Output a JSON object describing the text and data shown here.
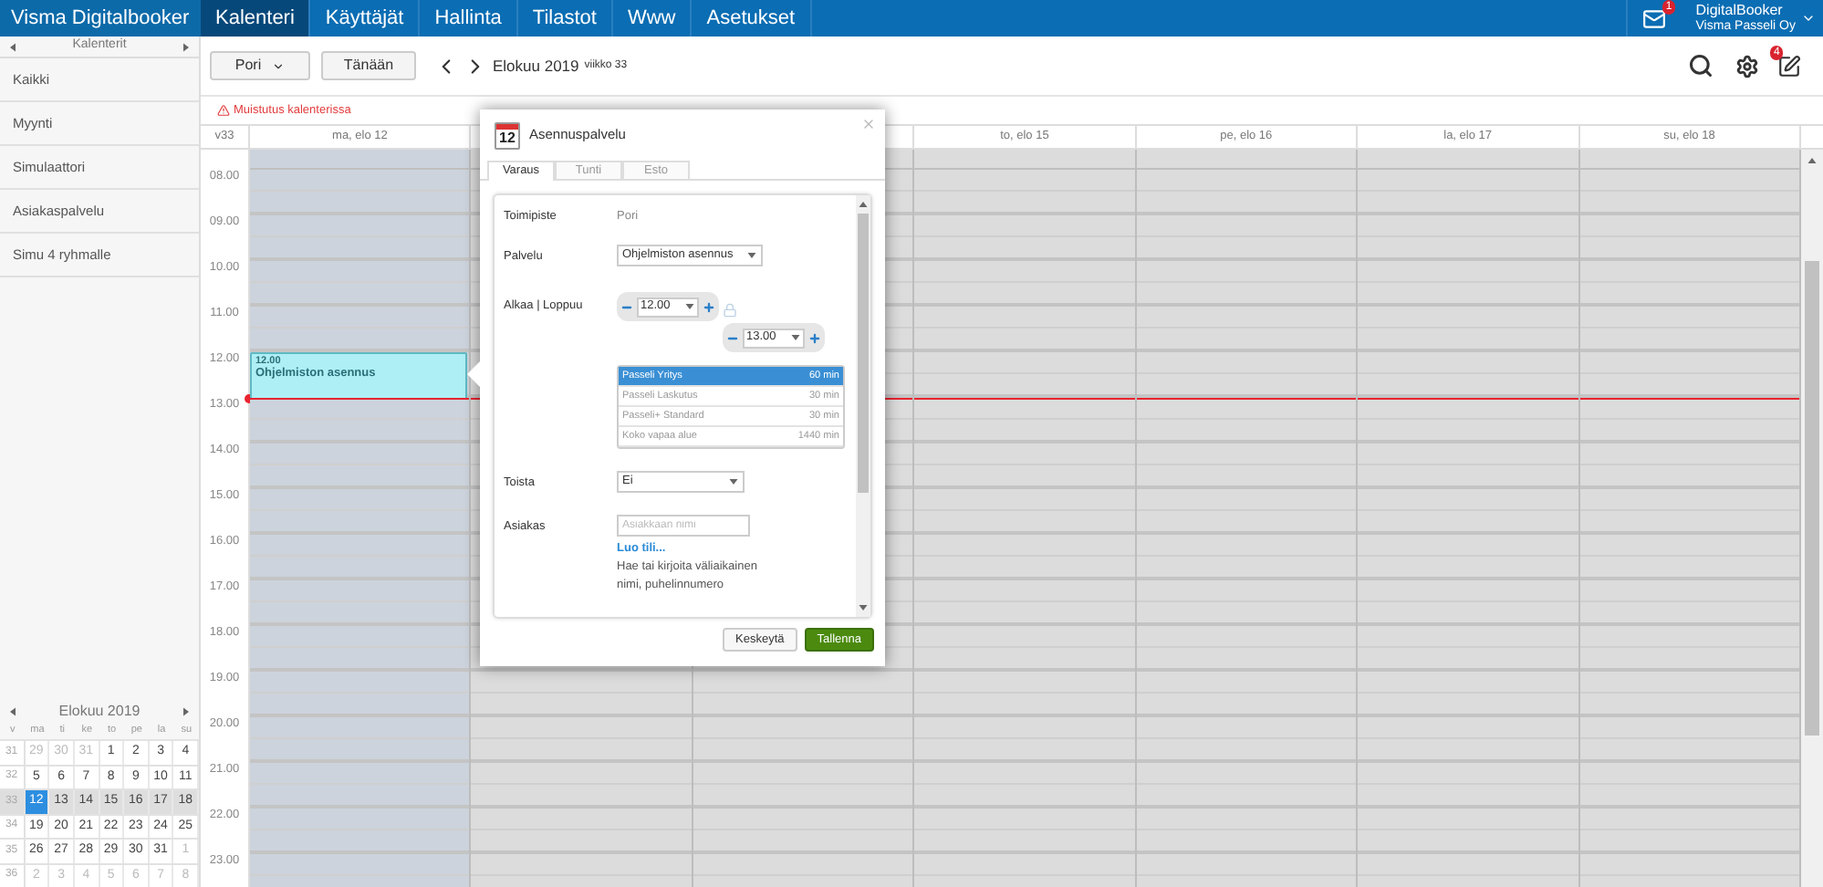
{
  "brand": "Visma Digitalbooker",
  "nav": [
    {
      "label": "Kalenteri",
      "selected": true
    },
    {
      "label": "Käyttäjät",
      "selected": false
    },
    {
      "label": "Hallinta",
      "selected": false
    },
    {
      "label": "Tilastot",
      "selected": false
    },
    {
      "label": "Www",
      "selected": false
    },
    {
      "label": "Asetukset",
      "selected": false
    }
  ],
  "mail_badge": "1",
  "user": {
    "name": "DigitalBooker",
    "company": "Visma Passeli Oy"
  },
  "sidebar": {
    "title": "Kalenterit",
    "items": [
      {
        "label": "Kaikki"
      },
      {
        "label": "Myynti"
      },
      {
        "label": "Simulaattori"
      },
      {
        "label": "Asiakaspalvelu"
      },
      {
        "label": "Simu 4 ryhmalle"
      }
    ]
  },
  "mini_calendar": {
    "title": "Elokuu 2019",
    "weekdays": [
      "v",
      "ma",
      "ti",
      "ke",
      "to",
      "pe",
      "la",
      "su"
    ],
    "weeks": [
      {
        "number": "31",
        "selected": false,
        "days": [
          {
            "label": "29",
            "muted": true,
            "selected": false
          },
          {
            "label": "30",
            "muted": true,
            "selected": false
          },
          {
            "label": "31",
            "muted": true,
            "selected": false
          },
          {
            "label": "1",
            "muted": false,
            "selected": false
          },
          {
            "label": "2",
            "muted": false,
            "selected": false
          },
          {
            "label": "3",
            "muted": false,
            "selected": false
          },
          {
            "label": "4",
            "muted": false,
            "selected": false
          }
        ]
      },
      {
        "number": "32",
        "selected": false,
        "days": [
          {
            "label": "5",
            "muted": false,
            "selected": false
          },
          {
            "label": "6",
            "muted": false,
            "selected": false
          },
          {
            "label": "7",
            "muted": false,
            "selected": false
          },
          {
            "label": "8",
            "muted": false,
            "selected": false
          },
          {
            "label": "9",
            "muted": false,
            "selected": false
          },
          {
            "label": "10",
            "muted": false,
            "selected": false
          },
          {
            "label": "11",
            "muted": false,
            "selected": false
          }
        ]
      },
      {
        "number": "33",
        "selected": true,
        "days": [
          {
            "label": "12",
            "muted": false,
            "selected": true
          },
          {
            "label": "13",
            "muted": false,
            "selected": false
          },
          {
            "label": "14",
            "muted": false,
            "selected": false
          },
          {
            "label": "15",
            "muted": false,
            "selected": false
          },
          {
            "label": "16",
            "muted": false,
            "selected": false
          },
          {
            "label": "17",
            "muted": false,
            "selected": false
          },
          {
            "label": "18",
            "muted": false,
            "selected": false
          }
        ]
      },
      {
        "number": "34",
        "selected": false,
        "days": [
          {
            "label": "19",
            "muted": false,
            "selected": false
          },
          {
            "label": "20",
            "muted": false,
            "selected": false
          },
          {
            "label": "21",
            "muted": false,
            "selected": false
          },
          {
            "label": "22",
            "muted": false,
            "selected": false
          },
          {
            "label": "23",
            "muted": false,
            "selected": false
          },
          {
            "label": "24",
            "muted": false,
            "selected": false
          },
          {
            "label": "25",
            "muted": false,
            "selected": false
          }
        ]
      },
      {
        "number": "35",
        "selected": false,
        "days": [
          {
            "label": "26",
            "muted": false,
            "selected": false
          },
          {
            "label": "27",
            "muted": false,
            "selected": false
          },
          {
            "label": "28",
            "muted": false,
            "selected": false
          },
          {
            "label": "29",
            "muted": false,
            "selected": false
          },
          {
            "label": "30",
            "muted": false,
            "selected": false
          },
          {
            "label": "31",
            "muted": false,
            "selected": false
          },
          {
            "label": "1",
            "muted": true,
            "selected": false
          }
        ]
      },
      {
        "number": "36",
        "selected": false,
        "days": [
          {
            "label": "2",
            "muted": true,
            "selected": false
          },
          {
            "label": "3",
            "muted": true,
            "selected": false
          },
          {
            "label": "4",
            "muted": true,
            "selected": false
          },
          {
            "label": "5",
            "muted": true,
            "selected": false
          },
          {
            "label": "6",
            "muted": true,
            "selected": false
          },
          {
            "label": "7",
            "muted": true,
            "selected": false
          },
          {
            "label": "8",
            "muted": true,
            "selected": false
          }
        ]
      }
    ]
  },
  "toolbar": {
    "location": "Pori",
    "today": "Tänään",
    "month": "Elokuu 2019",
    "week": "viikko 33",
    "edit_badge": "4"
  },
  "alert": "Muistutus kalenterissa",
  "calendar": {
    "week_label": "v33",
    "days": [
      {
        "label": "ma, elo 12",
        "selected": true,
        "events": [
          {
            "time": "12.00",
            "title": "Ohjelmiston asennus"
          }
        ]
      },
      {
        "selected": false
      },
      {
        "selected": false
      },
      {
        "label": "to, elo 15",
        "selected": false
      },
      {
        "label": "pe, elo 16",
        "selected": false
      },
      {
        "label": "la, elo 17",
        "selected": false
      },
      {
        "label": "su, elo 18",
        "selected": false
      }
    ],
    "hours": [
      "08.00",
      "09.00",
      "10.00",
      "11.00",
      "12.00",
      "13.00",
      "14.00",
      "15.00",
      "16.00",
      "17.00",
      "18.00",
      "19.00",
      "20.00",
      "21.00",
      "22.00",
      "23.00"
    ]
  },
  "dialog": {
    "icon_day": "12",
    "title": "Asennuspalvelu",
    "tabs": [
      {
        "label": "Varaus",
        "selected": true
      },
      {
        "label": "Tunti",
        "selected": false
      },
      {
        "label": "Esto",
        "selected": false
      }
    ],
    "location_label": "Toimipiste",
    "location": "Pori",
    "service_label": "Palvelu",
    "service": "Ohjelmiston asennus",
    "time_label": "Alkaa | Loppuu",
    "start": "12.00",
    "end": "13.00",
    "services": [
      {
        "name": "Passeli Yritys",
        "duration": "60 min",
        "selected": true
      },
      {
        "name": "Passeli Laskutus",
        "duration": "30 min",
        "selected": false
      },
      {
        "name": "Passeli+ Standard",
        "duration": "30 min",
        "selected": false
      },
      {
        "name": "Koko vapaa alue",
        "duration": "1440 min",
        "selected": false
      }
    ],
    "repeat_label": "Toista",
    "repeat": "Ei",
    "customer_label": "Asiakas",
    "customer_placeholder": "Asiakkaan nimi",
    "create_link": "Luo tili...",
    "hint": "Hae tai kirjoita väliaikainen nimi, puhelinnumero",
    "buttons": [
      {
        "kind": "secondary",
        "label": "Keskeytä"
      },
      {
        "kind": "primary",
        "label": "Tallenna"
      }
    ]
  }
}
